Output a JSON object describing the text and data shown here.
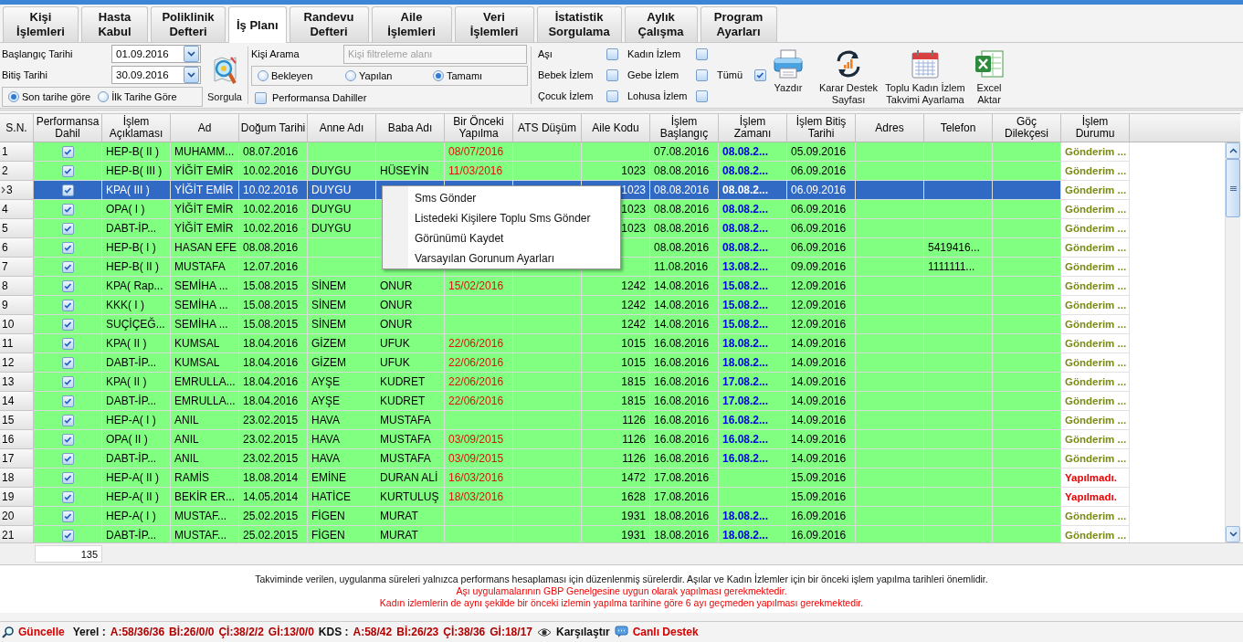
{
  "tabs": [
    {
      "label": "Kişi İşlemleri",
      "selected": false
    },
    {
      "label": "Hasta Kabul",
      "selected": false
    },
    {
      "label": "Poliklinik Defteri",
      "selected": false
    },
    {
      "label": "İş Planı",
      "selected": true
    },
    {
      "label": "Randevu Defteri",
      "selected": false
    },
    {
      "label": "Aile İşlemleri",
      "selected": false
    },
    {
      "label": "Veri İşlemleri",
      "selected": false
    },
    {
      "label": "İstatistik Sorgulama",
      "selected": false
    },
    {
      "label": "Aylık Çalışma",
      "selected": false
    },
    {
      "label": "Program Ayarları",
      "selected": false
    }
  ],
  "date_filters": [
    {
      "label": "Başlangıç Tarihi",
      "value": "01.09.2016"
    },
    {
      "label": "Bitiş Tarihi",
      "value": "30.09.2016"
    }
  ],
  "date_mode": [
    {
      "label": "Son tarihe göre",
      "selected": true
    },
    {
      "label": "İlk Tarihe Göre",
      "selected": false
    }
  ],
  "query_button": {
    "label": "Sorgula"
  },
  "person_search": {
    "label": "Kişi Arama",
    "placeholder": "Kişi filtreleme alanı"
  },
  "status_filter": [
    {
      "label": "Bekleyen",
      "selected": false
    },
    {
      "label": "Yapılan",
      "selected": false
    },
    {
      "label": "Tamamı",
      "selected": true
    }
  ],
  "performance_only": {
    "label": "Performansa Dahiller",
    "checked": false
  },
  "type_filters": [
    {
      "label": "Aşı",
      "checked": false
    },
    {
      "label": "Bebek İzlem",
      "checked": false
    },
    {
      "label": "Çocuk İzlem",
      "checked": false
    },
    {
      "label": "Kadın İzlem",
      "checked": false
    },
    {
      "label": "Gebe İzlem",
      "checked": false
    },
    {
      "label": "Lohusa İzlem",
      "checked": false
    }
  ],
  "all_types": {
    "label": "Tümü",
    "checked": true
  },
  "actions": [
    {
      "label": "Yazdır",
      "kind": "print"
    },
    {
      "label": "Karar Destek Sayfası",
      "kind": "decision"
    },
    {
      "label": "Toplu Kadın İzlem Takvimi Ayarlama",
      "kind": "calendar"
    },
    {
      "label": "Excel Aktar",
      "kind": "excel"
    }
  ],
  "table": {
    "columns": [
      "S.N.",
      "Performansa Dahil",
      "İşlem Açıklaması",
      "Ad",
      "Doğum Tarihi",
      "Anne Adı",
      "Baba Adı",
      "Bir Önceki Yapılma",
      "ATS Düşüm",
      "Aile Kodu",
      "İşlem Başlangıç",
      "İşlem Zamanı",
      "İşlem Bitiş Tarihi",
      "Adres",
      "Telefon",
      "Göç Dilekçesi",
      "İşlem Durumu"
    ],
    "rows": [
      {
        "selected": false,
        "sn": "1",
        "performansa_dahil": true,
        "islem_aciklamasi": "HEP-B( II )",
        "ad": "MUHAMM...",
        "dogum_tarihi": "08.07.2016",
        "bir_onceki_yapilma": "08/07/2016",
        "islem_baslangic": "07.08.2016",
        "islem_zamani": "08.08.2...",
        "islem_bitis_tarihi": "05.09.2016",
        "islem_durumu": "Gönderim ...",
        "kind": "sent"
      },
      {
        "selected": false,
        "sn": "2",
        "performansa_dahil": true,
        "islem_aciklamasi": "HEP-B( III )",
        "ad": "YİĞİT EMİR",
        "dogum_tarihi": "10.02.2016",
        "anne_adi": "DUYGU",
        "baba_adi": "HÜSEYİN",
        "bir_onceki_yapilma": "11/03/2016",
        "aile_kodu": "1023",
        "islem_baslangic": "08.08.2016",
        "islem_zamani": "08.08.2...",
        "islem_bitis_tarihi": "06.09.2016",
        "islem_durumu": "Gönderim ...",
        "kind": "sent"
      },
      {
        "selected": true,
        "sn": "3",
        "performansa_dahil": true,
        "islem_aciklamasi": "KPA( III )",
        "ad": "YİĞİT EMİR",
        "dogum_tarihi": "10.02.2016",
        "anne_adi": "DUYGU",
        "aile_kodu": "1023",
        "islem_baslangic": "08.08.2016",
        "islem_zamani": "08.08.2...",
        "islem_bitis_tarihi": "06.09.2016",
        "islem_durumu": "Gönderim ...",
        "kind": "sent"
      },
      {
        "selected": false,
        "sn": "4",
        "performansa_dahil": true,
        "islem_aciklamasi": "OPA( I )",
        "ad": "YİĞİT EMİR",
        "dogum_tarihi": "10.02.2016",
        "anne_adi": "DUYGU",
        "aile_kodu": "1023",
        "islem_baslangic": "08.08.2016",
        "islem_zamani": "08.08.2...",
        "islem_bitis_tarihi": "06.09.2016",
        "islem_durumu": "Gönderim ...",
        "kind": "sent"
      },
      {
        "selected": false,
        "sn": "5",
        "performansa_dahil": true,
        "islem_aciklamasi": "DABT-İP...",
        "ad": "YİĞİT EMİR",
        "dogum_tarihi": "10.02.2016",
        "anne_adi": "DUYGU",
        "aile_kodu": "1023",
        "islem_baslangic": "08.08.2016",
        "islem_zamani": "08.08.2...",
        "islem_bitis_tarihi": "06.09.2016",
        "islem_durumu": "Gönderim ...",
        "kind": "sent"
      },
      {
        "selected": false,
        "sn": "6",
        "performansa_dahil": true,
        "islem_aciklamasi": "HEP-B( I )",
        "ad": "HASAN EFE",
        "dogum_tarihi": "08.08.2016",
        "islem_baslangic": "08.08.2016",
        "islem_zamani": "08.08.2...",
        "islem_bitis_tarihi": "06.09.2016",
        "telefon": "5419416...",
        "islem_durumu": "Gönderim ...",
        "kind": "sent"
      },
      {
        "selected": false,
        "sn": "7",
        "performansa_dahil": true,
        "islem_aciklamasi": "HEP-B( II )",
        "ad": "MUSTAFA",
        "dogum_tarihi": "12.07.2016",
        "islem_baslangic": "11.08.2016",
        "islem_zamani": "13.08.2...",
        "islem_bitis_tarihi": "09.09.2016",
        "telefon": "1111111...",
        "islem_durumu": "Gönderim ...",
        "kind": "sent"
      },
      {
        "selected": false,
        "sn": "8",
        "performansa_dahil": true,
        "islem_aciklamasi": "KPA( Rap...",
        "ad": "SEMİHA ...",
        "dogum_tarihi": "15.08.2015",
        "anne_adi": "SİNEM",
        "baba_adi": "ONUR",
        "bir_onceki_yapilma": "15/02/2016",
        "aile_kodu": "1242",
        "islem_baslangic": "14.08.2016",
        "islem_zamani": "15.08.2...",
        "islem_bitis_tarihi": "12.09.2016",
        "islem_durumu": "Gönderim ...",
        "kind": "sent"
      },
      {
        "selected": false,
        "sn": "9",
        "performansa_dahil": true,
        "islem_aciklamasi": "KKK( I )",
        "ad": "SEMİHA ...",
        "dogum_tarihi": "15.08.2015",
        "anne_adi": "SİNEM",
        "baba_adi": "ONUR",
        "aile_kodu": "1242",
        "islem_baslangic": "14.08.2016",
        "islem_zamani": "15.08.2...",
        "islem_bitis_tarihi": "12.09.2016",
        "islem_durumu": "Gönderim ...",
        "kind": "sent"
      },
      {
        "selected": false,
        "sn": "10",
        "performansa_dahil": true,
        "islem_aciklamasi": "SUÇİÇEĞ...",
        "ad": "SEMİHA ...",
        "dogum_tarihi": "15.08.2015",
        "anne_adi": "SİNEM",
        "baba_adi": "ONUR",
        "aile_kodu": "1242",
        "islem_baslangic": "14.08.2016",
        "islem_zamani": "15.08.2...",
        "islem_bitis_tarihi": "12.09.2016",
        "islem_durumu": "Gönderim ...",
        "kind": "sent"
      },
      {
        "selected": false,
        "sn": "11",
        "performansa_dahil": true,
        "islem_aciklamasi": "KPA( II )",
        "ad": "KUMSAL",
        "dogum_tarihi": "18.04.2016",
        "anne_adi": "GİZEM",
        "baba_adi": "UFUK",
        "bir_onceki_yapilma": "22/06/2016",
        "aile_kodu": "1015",
        "islem_baslangic": "16.08.2016",
        "islem_zamani": "18.08.2...",
        "islem_bitis_tarihi": "14.09.2016",
        "islem_durumu": "Gönderim ...",
        "kind": "sent"
      },
      {
        "selected": false,
        "sn": "12",
        "performansa_dahil": true,
        "islem_aciklamasi": "DABT-İP...",
        "ad": "KUMSAL",
        "dogum_tarihi": "18.04.2016",
        "anne_adi": "GİZEM",
        "baba_adi": "UFUK",
        "bir_onceki_yapilma": "22/06/2016",
        "aile_kodu": "1015",
        "islem_baslangic": "16.08.2016",
        "islem_zamani": "18.08.2...",
        "islem_bitis_tarihi": "14.09.2016",
        "islem_durumu": "Gönderim ...",
        "kind": "sent"
      },
      {
        "selected": false,
        "sn": "13",
        "performansa_dahil": true,
        "islem_aciklamasi": "KPA( II )",
        "ad": "EMRULLA...",
        "dogum_tarihi": "18.04.2016",
        "anne_adi": "AYŞE",
        "baba_adi": "KUDRET",
        "bir_onceki_yapilma": "22/06/2016",
        "aile_kodu": "1815",
        "islem_baslangic": "16.08.2016",
        "islem_zamani": "17.08.2...",
        "islem_bitis_tarihi": "14.09.2016",
        "islem_durumu": "Gönderim ...",
        "kind": "sent"
      },
      {
        "selected": false,
        "sn": "14",
        "performansa_dahil": true,
        "islem_aciklamasi": "DABT-İP...",
        "ad": "EMRULLA...",
        "dogum_tarihi": "18.04.2016",
        "anne_adi": "AYŞE",
        "baba_adi": "KUDRET",
        "bir_onceki_yapilma": "22/06/2016",
        "aile_kodu": "1815",
        "islem_baslangic": "16.08.2016",
        "islem_zamani": "17.08.2...",
        "islem_bitis_tarihi": "14.09.2016",
        "islem_durumu": "Gönderim ...",
        "kind": "sent"
      },
      {
        "selected": false,
        "sn": "15",
        "performansa_dahil": true,
        "islem_aciklamasi": "HEP-A( I )",
        "ad": "ANIL",
        "dogum_tarihi": "23.02.2015",
        "anne_adi": "HAVA",
        "baba_adi": "MUSTAFA",
        "aile_kodu": "1126",
        "islem_baslangic": "16.08.2016",
        "islem_zamani": "16.08.2...",
        "islem_bitis_tarihi": "14.09.2016",
        "islem_durumu": "Gönderim ...",
        "kind": "sent"
      },
      {
        "selected": false,
        "sn": "16",
        "performansa_dahil": true,
        "islem_aciklamasi": "OPA( II )",
        "ad": "ANIL",
        "dogum_tarihi": "23.02.2015",
        "anne_adi": "HAVA",
        "baba_adi": "MUSTAFA",
        "bir_onceki_yapilma": "03/09/2015",
        "aile_kodu": "1126",
        "islem_baslangic": "16.08.2016",
        "islem_zamani": "16.08.2...",
        "islem_bitis_tarihi": "14.09.2016",
        "islem_durumu": "Gönderim ...",
        "kind": "sent"
      },
      {
        "selected": false,
        "sn": "17",
        "performansa_dahil": true,
        "islem_aciklamasi": "DABT-İP...",
        "ad": "ANIL",
        "dogum_tarihi": "23.02.2015",
        "anne_adi": "HAVA",
        "baba_adi": "MUSTAFA",
        "bir_onceki_yapilma": "03/09/2015",
        "aile_kodu": "1126",
        "islem_baslangic": "16.08.2016",
        "islem_zamani": "16.08.2...",
        "islem_bitis_tarihi": "14.09.2016",
        "islem_durumu": "Gönderim ...",
        "kind": "sent"
      },
      {
        "selected": false,
        "sn": "18",
        "performansa_dahil": true,
        "islem_aciklamasi": "HEP-A( II )",
        "ad": "RAMİS",
        "dogum_tarihi": "18.08.2014",
        "anne_adi": "EMİNE",
        "baba_adi": "DURAN ALİ",
        "bir_onceki_yapilma": "16/03/2016",
        "aile_kodu": "1472",
        "islem_baslangic": "17.08.2016",
        "islem_bitis_tarihi": "15.09.2016",
        "islem_durumu": "Yapılmadı.",
        "kind": "not_done"
      },
      {
        "selected": false,
        "sn": "19",
        "performansa_dahil": true,
        "islem_aciklamasi": "HEP-A( II )",
        "ad": "BEKİR ER...",
        "dogum_tarihi": "14.05.2014",
        "anne_adi": "HATİCE",
        "baba_adi": "KURTULUŞ",
        "bir_onceki_yapilma": "18/03/2016",
        "aile_kodu": "1628",
        "islem_baslangic": "17.08.2016",
        "islem_bitis_tarihi": "15.09.2016",
        "islem_durumu": "Yapılmadı.",
        "kind": "not_done"
      },
      {
        "selected": false,
        "sn": "20",
        "performansa_dahil": true,
        "islem_aciklamasi": "HEP-A( I )",
        "ad": "MUSTAF...",
        "dogum_tarihi": "25.02.2015",
        "anne_adi": "FİGEN",
        "baba_adi": "MURAT",
        "aile_kodu": "1931",
        "islem_baslangic": "18.08.2016",
        "islem_zamani": "18.08.2...",
        "islem_bitis_tarihi": "16.09.2016",
        "islem_durumu": "Gönderim ...",
        "kind": "sent"
      },
      {
        "selected": false,
        "sn": "21",
        "performansa_dahil": true,
        "islem_aciklamasi": "DABT-İP...",
        "ad": "MUSTAF...",
        "dogum_tarihi": "25.02.2015",
        "anne_adi": "FİGEN",
        "baba_adi": "MURAT",
        "aile_kodu": "1931",
        "islem_baslangic": "18.08.2016",
        "islem_zamani": "18.08.2...",
        "islem_bitis_tarihi": "16.09.2016",
        "islem_durumu": "Gönderim ...",
        "kind": "sent"
      }
    ],
    "summary": {
      "count": "135"
    }
  },
  "context_menu": [
    "Sms Gönder",
    "Listedeki Kişilere Toplu Sms Gönder",
    "Görünümü Kaydet",
    "Varsayılan Gorunum Ayarları"
  ],
  "notes": [
    {
      "text": "Takviminde verilen, uygulanma süreleri yalnızca performans hesaplaması için düzenlenmiş sürelerdir. Aşılar ve Kadın İzlemler için bir önceki işlem yapılma tarihleri önemlidir.",
      "kind": "info"
    },
    {
      "text": "Aşı uygulamalarının GBP Genelgesine uygun olarak yapılması gerekmektedir.",
      "kind": "warning"
    },
    {
      "text": "Kadın izlemlerin de aynı şekilde bir önceki izlemin yapılma tarihine göre 6 ayı geçmeden yapılması gerekmektedir.",
      "kind": "warning"
    }
  ],
  "status_bar": [
    {
      "text": "Güncelle",
      "kind": "search_link"
    },
    {
      "text": "Yerel :",
      "kind": "label"
    },
    {
      "text": "A:58/36/36",
      "kind": "value"
    },
    {
      "text": "Bİ:26/0/0",
      "kind": "value"
    },
    {
      "text": "Çİ:38/2/2",
      "kind": "value"
    },
    {
      "text": "Gİ:13/0/0",
      "kind": "value"
    },
    {
      "text": "KDS :",
      "kind": "label"
    },
    {
      "text": "A:58/42",
      "kind": "value"
    },
    {
      "text": "Bİ:26/23",
      "kind": "value"
    },
    {
      "text": "Çİ:38/36",
      "kind": "value"
    },
    {
      "text": "Gİ:18/17",
      "kind": "value"
    },
    {
      "text": "Karşılaştır",
      "kind": "compare_link"
    },
    {
      "text": "Canlı Destek",
      "kind": "chat_link"
    }
  ]
}
